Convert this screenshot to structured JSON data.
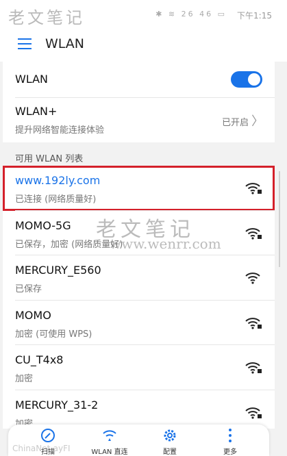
{
  "status_bar": {
    "time": "下午1:15",
    "icons": "✱ ≋ 26 46 ▭"
  },
  "watermark": {
    "text_cn": "老文笔记",
    "url": "www.wenrr.com"
  },
  "app_bar": {
    "title": "WLAN"
  },
  "wlan_toggle": {
    "label": "WLAN",
    "state": "on"
  },
  "wlan_plus": {
    "label": "WLAN+",
    "subtitle": "提升网络智能连接体验",
    "status": "已开启"
  },
  "section_header": "可用 WLAN 列表",
  "networks": [
    {
      "name": "www.192ly.com",
      "status": "已连接 (网络质量好)",
      "locked": true,
      "selected": true
    },
    {
      "name": "MOMO-5G",
      "status": "已保存，加密 (网络质量好)",
      "locked": true
    },
    {
      "name": "MERCURY_E560",
      "status": "已保存",
      "locked": false
    },
    {
      "name": "MOMO",
      "status": "加密 (可使用 WPS)",
      "locked": true
    },
    {
      "name": "CU_T4x8",
      "status": "加密",
      "locked": true
    },
    {
      "name": "MERCURY_31-2",
      "status": "加密",
      "locked": true
    }
  ],
  "bottom_tabs": [
    {
      "label": "扫描",
      "icon": "scan-icon"
    },
    {
      "label": "WLAN 直连",
      "icon": "wifi-direct-icon"
    },
    {
      "label": "配置",
      "icon": "gear-icon"
    },
    {
      "label": "更多",
      "icon": "more-icon"
    }
  ],
  "bottom_watermark": "ChinaNet-ayFI",
  "colors": {
    "accent": "#1a73e8",
    "highlight": "#d4202a"
  }
}
